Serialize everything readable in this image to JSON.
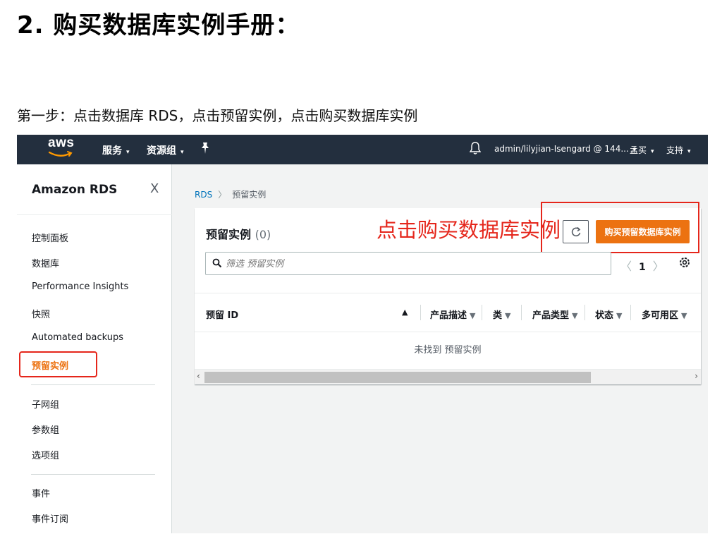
{
  "doc": {
    "title": "2. 购买数据库实例手册：",
    "step": "第一步：点击数据库 RDS，点击预留实例，点击购买数据库实例"
  },
  "topnav": {
    "logo": "aws",
    "services": "服务",
    "resource_groups": "资源组",
    "account": "admin/lilyjian-Isengard @ 144...",
    "region": "孟买",
    "support": "支持"
  },
  "sidebar": {
    "title": "Amazon RDS",
    "close": "X",
    "groups": [
      [
        "控制面板",
        "数据库",
        "Performance Insights",
        "快照",
        "Automated backups",
        "预留实例"
      ],
      [
        "子网组",
        "参数组",
        "选项组"
      ],
      [
        "事件",
        "事件订阅"
      ]
    ],
    "active": "预留实例"
  },
  "breadcrumb": {
    "root": "RDS",
    "current": "预留实例"
  },
  "panel": {
    "title": "预留实例",
    "count": "(0)",
    "annotation": "点击购买数据库实例",
    "buy_button": "购买预留数据库实例",
    "filter_placeholder": "筛选 预留实例",
    "page": "1",
    "columns": [
      "预留 ID",
      "产品描述",
      "类",
      "产品类型",
      "状态",
      "多可用区"
    ],
    "empty_text": "未找到 预留实例"
  },
  "colors": {
    "nav_bg": "#232f3e",
    "accent": "#ec7211",
    "annotation": "#e5261b",
    "link": "#0073bb"
  }
}
